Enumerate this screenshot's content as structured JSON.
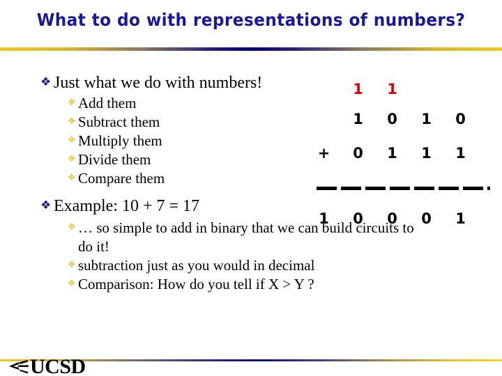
{
  "slide": {
    "title": "What to do with representations of numbers?",
    "title_color": "#1a1a8c",
    "background_color": "#ffffff",
    "accent_gold": "#e9c72e",
    "accent_navy": "#060169"
  },
  "bullets": {
    "level1_glyph": "❖",
    "level2_glyph": "❖",
    "items": [
      {
        "level": 1,
        "text": "Just what we do with numbers!"
      },
      {
        "level": 2,
        "text": "Add them"
      },
      {
        "level": 2,
        "text": "Subtract them"
      },
      {
        "level": 2,
        "text": "Multiply them"
      },
      {
        "level": 2,
        "text": "Divide them"
      },
      {
        "level": 2,
        "text": "Compare them"
      },
      {
        "level": 1,
        "text": "Example: 10 + 7 = 17"
      },
      {
        "level": 2,
        "text": "… so simple to add in binary that we can build circuits to do it!"
      },
      {
        "level": 2,
        "text": "subtraction just as you would in decimal"
      },
      {
        "level": 2,
        "text": "Comparison: How do you tell if X > Y ?"
      }
    ]
  },
  "binary_addition": {
    "carry_color": "#cc0808",
    "carry_row": [
      "",
      "1",
      "1",
      "",
      ""
    ],
    "addend_row": [
      "",
      "1",
      "0",
      "1",
      "0"
    ],
    "operator": "+",
    "augend_row": [
      "+",
      "0",
      "1",
      "1",
      "1"
    ],
    "sum_row": [
      "1",
      "0",
      "0",
      "0",
      "1"
    ],
    "decimal_expression": "10 + 7 = 17"
  },
  "footer": {
    "logo_text": "UCSD",
    "logo_mark": "trident-icon"
  }
}
